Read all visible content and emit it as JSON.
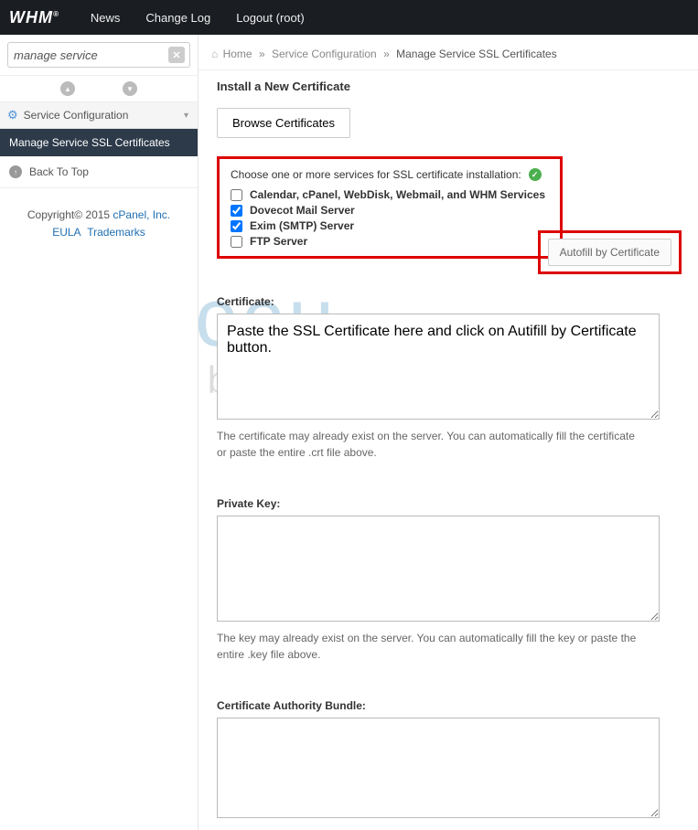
{
  "topnav": {
    "logo": "WHM",
    "links": [
      "News",
      "Change Log",
      "Logout (root)"
    ]
  },
  "sidebar": {
    "search_value": "manage service",
    "section_header": "Service Configuration",
    "active_item": "Manage Service SSL Certificates",
    "back_to_top": "Back To Top",
    "copyright_prefix": "Copyright© 2015 ",
    "copyright_link": "cPanel, Inc.",
    "eula": "EULA",
    "trademarks": "Trademarks"
  },
  "breadcrumb": {
    "home": "Home",
    "mid": "Service Configuration",
    "current": "Manage Service SSL Certificates"
  },
  "page": {
    "title": "Install a New Certificate",
    "browse_btn": "Browse Certificates",
    "services_prompt": "Choose one or more services for SSL certificate installation:",
    "services": [
      {
        "label": "Calendar, cPanel, WebDisk, Webmail, and WHM Services",
        "checked": false
      },
      {
        "label": "Dovecot Mail Server",
        "checked": true
      },
      {
        "label": "Exim (SMTP) Server",
        "checked": true
      },
      {
        "label": "FTP Server",
        "checked": false
      }
    ],
    "autofill_btn": "Autofill by Certificate",
    "cert_label": "Certificate:",
    "cert_value": "Paste the SSL Certificate here and click on Autifill by Certificate button.",
    "cert_help": "The certificate may already exist on the server. You can automatically fill the certificate or paste the entire .crt file above.",
    "key_label": "Private Key:",
    "key_help": "The key may already exist on the server. You can automatically fill the key or paste the entire .key file above.",
    "ca_label": "Certificate Authority Bundle:"
  },
  "watermark": {
    "line1": "accu",
    "line2": "web hosting"
  }
}
